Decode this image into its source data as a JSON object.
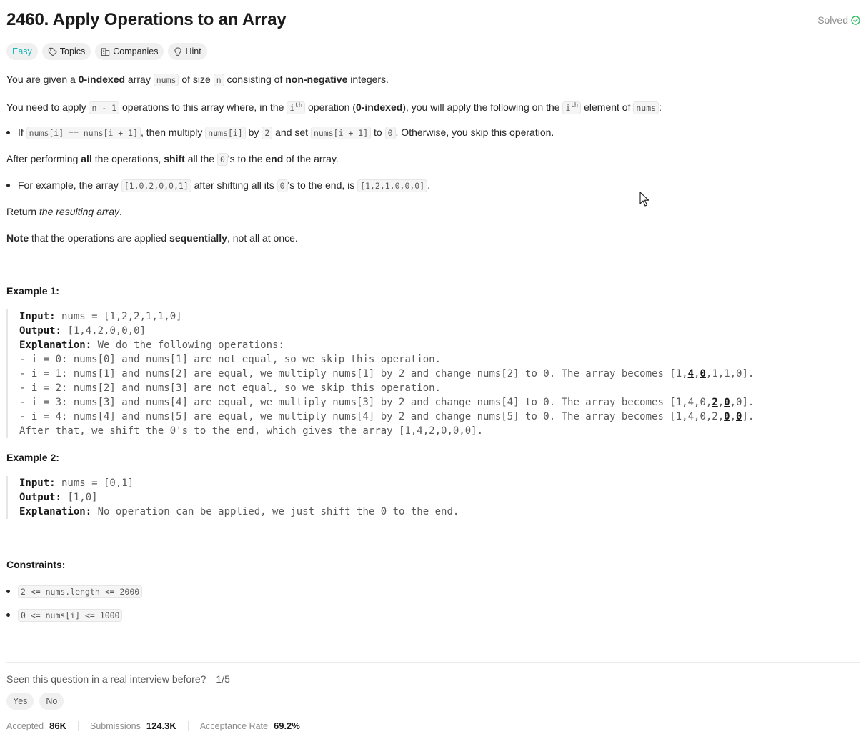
{
  "problem": {
    "title": "2460. Apply Operations to an Array",
    "status": "Solved",
    "tags": [
      "Easy",
      "Topics",
      "Companies",
      "Hint"
    ]
  },
  "description": {
    "p1": {
      "a": "You are given a ",
      "b": "0-indexed",
      "c": " array ",
      "d": "nums",
      "e": " of size ",
      "f": "n",
      "g": " consisting of ",
      "h": "non-negative",
      "i": " integers."
    },
    "p2": {
      "a": "You need to apply ",
      "b": "n - 1",
      "c": " operations to this array where, in the ",
      "d": "i",
      "d_sup": "th",
      "e": " operation (",
      "f": "0-indexed",
      "g": "), you will apply the following on the ",
      "h": "i",
      "h_sup": "th",
      "i": " element of ",
      "j": "nums",
      "k": ":"
    },
    "b1": {
      "a": "If ",
      "b": "nums[i] == nums[i + 1]",
      "c": ", then multiply ",
      "d": "nums[i]",
      "e": " by ",
      "f": "2",
      "g": " and set ",
      "h": "nums[i + 1]",
      "i": " to ",
      "j": "0",
      "k": ". Otherwise, you skip this operation."
    },
    "p3": {
      "a": "After performing ",
      "b": "all",
      "c": " the operations, ",
      "d": "shift",
      "e": " all the ",
      "f": "0",
      "g": "'s to the ",
      "h": "end",
      "i": " of the array."
    },
    "b2": {
      "a": "For example, the array ",
      "b": "[1,0,2,0,0,1]",
      "c": " after shifting all its ",
      "d": "0",
      "e": "'s to the end, is ",
      "f": "[1,2,1,0,0,0]",
      "g": "."
    },
    "p4": {
      "a": "Return ",
      "b": "the resulting array",
      "c": "."
    },
    "p5": {
      "a": "Note",
      "b": " that the operations are applied ",
      "c": "sequentially",
      "d": ", not all at once."
    }
  },
  "example1": {
    "heading": "Example 1:",
    "input_label": "Input:",
    "input": " nums = [1,2,2,1,1,0]",
    "output_label": "Output:",
    "output": " [1,4,2,0,0,0]",
    "expl_label": "Explanation:",
    "expl": " We do the following operations:",
    "l1": "- i = 0: nums[0] and nums[1] are not equal, so we skip this operation.",
    "l2a": "- i = 1: nums[1] and nums[2] are equal, we multiply nums[1] by 2 and change nums[2] to 0. The array becomes [1,",
    "l2b": "4",
    "l2c": ",",
    "l2d": "0",
    "l2e": ",1,1,0].",
    "l3": "- i = 2: nums[2] and nums[3] are not equal, so we skip this operation.",
    "l4a": "- i = 3: nums[3] and nums[4] are equal, we multiply nums[3] by 2 and change nums[4] to 0. The array becomes [1,4,0,",
    "l4b": "2",
    "l4c": ",",
    "l4d": "0",
    "l4e": ",0].",
    "l5a": "- i = 4: nums[4] and nums[5] are equal, we multiply nums[4] by 2 and change nums[5] to 0. The array becomes [1,4,0,2,",
    "l5b": "0",
    "l5c": ",",
    "l5d": "0",
    "l5e": "].",
    "l6": "After that, we shift the 0's to the end, which gives the array [1,4,2,0,0,0]."
  },
  "example2": {
    "heading": "Example 2:",
    "input_label": "Input:",
    "input": " nums = [0,1]",
    "output_label": "Output:",
    "output": " [1,0]",
    "expl_label": "Explanation:",
    "expl": " No operation can be applied, we just shift the 0 to the end."
  },
  "constraints": {
    "heading": "Constraints:",
    "items": [
      "2 <= nums.length <= 2000",
      "0 <= nums[i] <= 1000"
    ]
  },
  "footer": {
    "question": "Seen this question in a real interview before?",
    "count": "1/5",
    "yes": "Yes",
    "no": "No",
    "accepted_label": "Accepted",
    "accepted": "86K",
    "submissions_label": "Submissions",
    "submissions": "124.3K",
    "acceptance_label": "Acceptance Rate",
    "acceptance": "69.2%"
  },
  "colors": {
    "easy": "#1cb8b8",
    "solved_check": "#2cbb5d"
  },
  "icons": [
    "check-circle-icon",
    "tag-icon",
    "building-icon",
    "lightbulb-icon",
    "mouse-cursor-icon"
  ]
}
